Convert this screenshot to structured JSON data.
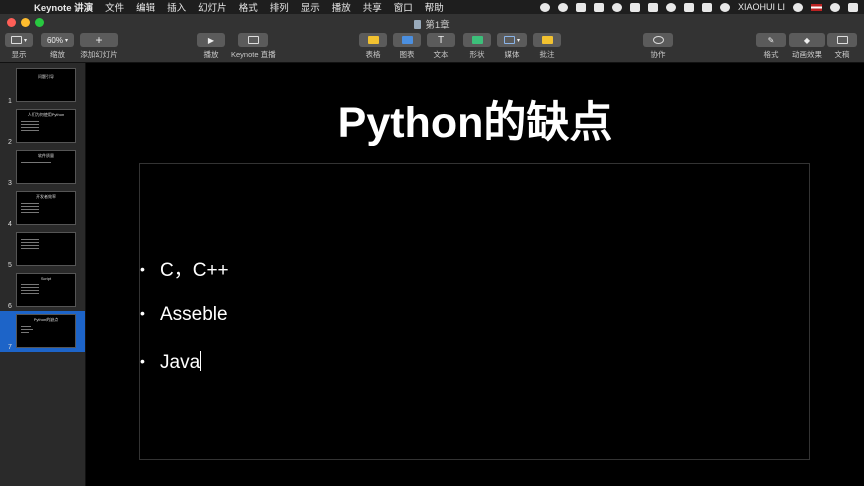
{
  "menubar": {
    "app_name": "Keynote 讲演",
    "items": [
      "文件",
      "编辑",
      "插入",
      "幻灯片",
      "格式",
      "排列",
      "显示",
      "播放",
      "共享",
      "窗口",
      "帮助"
    ],
    "user": "XIAOHUI LI"
  },
  "window": {
    "title": "第1章"
  },
  "toolbar": {
    "view": "显示",
    "zoom_value": "60%",
    "zoom_label": "缩放",
    "add_slide": "添加幻灯片",
    "play": "播放",
    "live": "Keynote 直播",
    "table": "表格",
    "chart": "图表",
    "text": "文本",
    "shape": "形状",
    "media": "媒体",
    "comment": "批注",
    "collaborate": "协作",
    "format": "格式",
    "animate": "动画效果",
    "document": "文稿"
  },
  "slides": [
    {
      "num": "1",
      "title": "问题引导"
    },
    {
      "num": "2",
      "title": "人们为何使用Python"
    },
    {
      "num": "3",
      "title": "软件质量"
    },
    {
      "num": "4",
      "title": "开发者效率"
    },
    {
      "num": "5",
      "title": ""
    },
    {
      "num": "6",
      "title": "Script"
    },
    {
      "num": "7",
      "title": "Python的缺点"
    }
  ],
  "current_slide": {
    "title": "Python的缺点",
    "bullets": [
      "C，C++",
      "Asseble",
      "Java"
    ]
  }
}
